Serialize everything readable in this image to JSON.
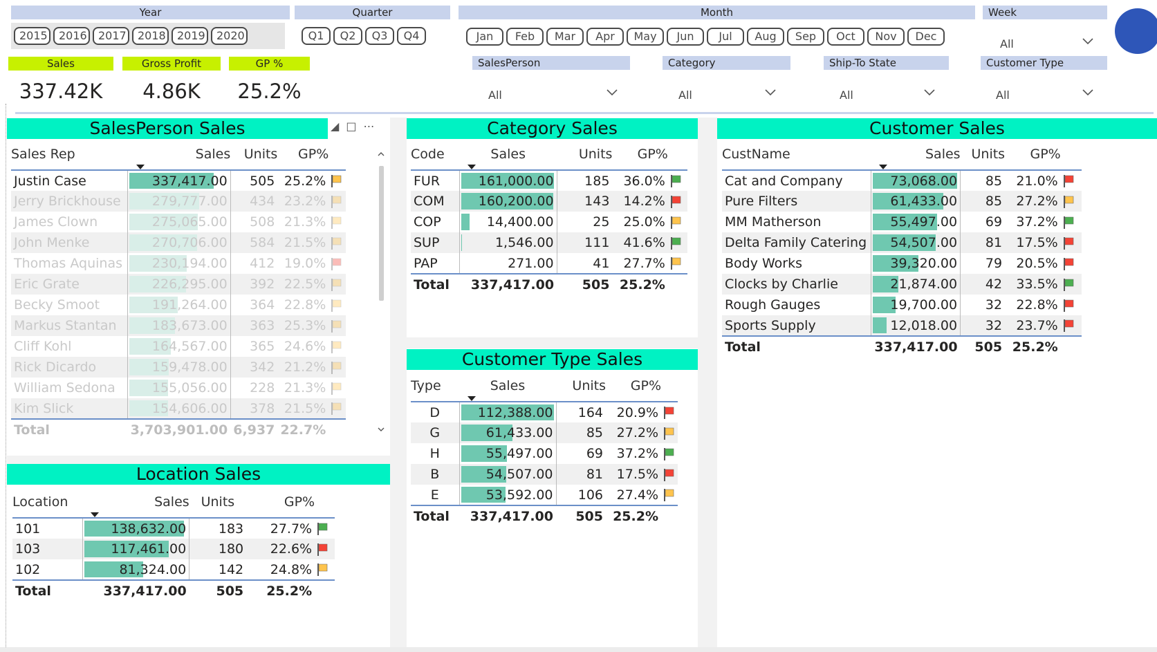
{
  "slicers": {
    "year": {
      "title": "Year",
      "options": [
        "2015",
        "2016",
        "2017",
        "2018",
        "2019",
        "2020"
      ]
    },
    "quarter": {
      "title": "Quarter",
      "options": [
        "Q1",
        "Q2",
        "Q3",
        "Q4"
      ]
    },
    "month": {
      "title": "Month",
      "options": [
        "Jan",
        "Feb",
        "Mar",
        "Apr",
        "May",
        "Jun",
        "Jul",
        "Aug",
        "Sep",
        "Oct",
        "Nov",
        "Dec"
      ]
    },
    "week": {
      "title": "Week",
      "value": "All"
    },
    "salesperson": {
      "title": "SalesPerson",
      "value": "All"
    },
    "category": {
      "title": "Category",
      "value": "All"
    },
    "ship_to_state": {
      "title": "Ship-To State",
      "value": "All"
    },
    "customer_type": {
      "title": "Customer Type",
      "value": "All"
    }
  },
  "kpis": {
    "sales": {
      "label": "Sales",
      "value": "337.42K"
    },
    "gross_profit": {
      "label": "Gross Profit",
      "value": "4.86K"
    },
    "gp_pct": {
      "label": "GP %",
      "value": "25.2%"
    }
  },
  "colors": {
    "accent": "#00f2c3",
    "kpi": "#c7f000",
    "bar": "#6fc8b0",
    "slicer": "#c8d3ec",
    "flag_green": "#4caf50",
    "flag_red": "#f44336",
    "flag_yellow": "#ffc44d"
  },
  "salesperson_sales": {
    "title": "SalesPerson Sales",
    "headers": [
      "Sales Rep",
      "Sales",
      "Units",
      "GP%"
    ],
    "rows": [
      {
        "name": "Justin Case",
        "sales": "337,417.00",
        "units": "505",
        "gp": "25.2%",
        "flag": "yellow",
        "pct": 1.0
      },
      {
        "name": "Jerry Brickhouse",
        "sales": "279,777.00",
        "units": "434",
        "gp": "23.2%",
        "flag": "yellow",
        "pct": 0.83
      },
      {
        "name": "James Clown",
        "sales": "275,065.00",
        "units": "508",
        "gp": "21.3%",
        "flag": "yellow",
        "pct": 0.815
      },
      {
        "name": "John Menke",
        "sales": "270,706.00",
        "units": "584",
        "gp": "21.5%",
        "flag": "yellow",
        "pct": 0.8
      },
      {
        "name": "Thomas Aquinas",
        "sales": "230,194.00",
        "units": "412",
        "gp": "19.0%",
        "flag": "red",
        "pct": 0.68
      },
      {
        "name": "Eric Grate",
        "sales": "226,295.00",
        "units": "392",
        "gp": "22.5%",
        "flag": "yellow",
        "pct": 0.67
      },
      {
        "name": "Becky Smoot",
        "sales": "191,264.00",
        "units": "364",
        "gp": "22.8%",
        "flag": "yellow",
        "pct": 0.57
      },
      {
        "name": "Markus Stantan",
        "sales": "183,673.00",
        "units": "363",
        "gp": "25.3%",
        "flag": "yellow",
        "pct": 0.54
      },
      {
        "name": "Cliff Kohl",
        "sales": "164,567.00",
        "units": "365",
        "gp": "24.6%",
        "flag": "yellow",
        "pct": 0.49
      },
      {
        "name": "Rick Dicardo",
        "sales": "159,478.00",
        "units": "342",
        "gp": "21.2%",
        "flag": "yellow",
        "pct": 0.47
      },
      {
        "name": "William Sedona",
        "sales": "155,056.00",
        "units": "228",
        "gp": "21.3%",
        "flag": "yellow",
        "pct": 0.46
      },
      {
        "name": "Kim Slick",
        "sales": "154,606.00",
        "units": "378",
        "gp": "21.5%",
        "flag": "yellow",
        "pct": 0.46
      }
    ],
    "total": {
      "label": "Total",
      "sales": "3,703,901.00",
      "units": "6,937",
      "gp": "22.7%"
    }
  },
  "location_sales": {
    "title": "Location Sales",
    "headers": [
      "Location",
      "Sales",
      "Units",
      "GP%"
    ],
    "rows": [
      {
        "name": "101",
        "sales": "138,632.00",
        "units": "183",
        "gp": "27.7%",
        "flag": "green",
        "pct": 1.0
      },
      {
        "name": "103",
        "sales": "117,461.00",
        "units": "180",
        "gp": "22.6%",
        "flag": "red",
        "pct": 0.85
      },
      {
        "name": "102",
        "sales": "81,324.00",
        "units": "142",
        "gp": "24.8%",
        "flag": "yellow",
        "pct": 0.59
      }
    ],
    "total": {
      "label": "Total",
      "sales": "337,417.00",
      "units": "505",
      "gp": "25.2%"
    }
  },
  "category_sales": {
    "title": "Category Sales",
    "headers": [
      "Code",
      "Sales",
      "Units",
      "GP%"
    ],
    "rows": [
      {
        "name": "FUR",
        "sales": "161,000.00",
        "units": "185",
        "gp": "36.0%",
        "flag": "green",
        "pct": 1.0
      },
      {
        "name": "COM",
        "sales": "160,200.00",
        "units": "143",
        "gp": "14.2%",
        "flag": "red",
        "pct": 0.995
      },
      {
        "name": "COP",
        "sales": "14,400.00",
        "units": "25",
        "gp": "25.0%",
        "flag": "yellow",
        "pct": 0.09
      },
      {
        "name": "SUP",
        "sales": "1,546.00",
        "units": "111",
        "gp": "41.6%",
        "flag": "green",
        "pct": 0.01
      },
      {
        "name": "PAP",
        "sales": "271.00",
        "units": "41",
        "gp": "27.7%",
        "flag": "yellow",
        "pct": 0.0
      }
    ],
    "total": {
      "label": "Total",
      "sales": "337,417.00",
      "units": "505",
      "gp": "25.2%"
    }
  },
  "customer_type_sales": {
    "title": "Customer Type Sales",
    "headers": [
      "Type",
      "Sales",
      "Units",
      "GP%"
    ],
    "rows": [
      {
        "name": "D",
        "sales": "112,388.00",
        "units": "164",
        "gp": "20.9%",
        "flag": "red",
        "pct": 1.0
      },
      {
        "name": "G",
        "sales": "61,433.00",
        "units": "85",
        "gp": "27.2%",
        "flag": "yellow",
        "pct": 0.55
      },
      {
        "name": "H",
        "sales": "55,497.00",
        "units": "69",
        "gp": "37.2%",
        "flag": "green",
        "pct": 0.49
      },
      {
        "name": "B",
        "sales": "54,507.00",
        "units": "81",
        "gp": "17.5%",
        "flag": "red",
        "pct": 0.485
      },
      {
        "name": "E",
        "sales": "53,592.00",
        "units": "106",
        "gp": "27.4%",
        "flag": "yellow",
        "pct": 0.48
      }
    ],
    "total": {
      "label": "Total",
      "sales": "337,417.00",
      "units": "505",
      "gp": "25.2%"
    }
  },
  "customer_sales": {
    "title": "Customer Sales",
    "headers": [
      "CustName",
      "Sales",
      "Units",
      "GP%"
    ],
    "rows": [
      {
        "name": "Cat and Company",
        "sales": "73,068.00",
        "units": "85",
        "gp": "21.0%",
        "flag": "red",
        "pct": 1.0
      },
      {
        "name": "Pure Filters",
        "sales": "61,433.00",
        "units": "85",
        "gp": "27.2%",
        "flag": "yellow",
        "pct": 0.84
      },
      {
        "name": "MM Matherson",
        "sales": "55,497.00",
        "units": "69",
        "gp": "37.2%",
        "flag": "green",
        "pct": 0.76
      },
      {
        "name": "Delta Family Catering",
        "sales": "54,507.00",
        "units": "81",
        "gp": "17.5%",
        "flag": "red",
        "pct": 0.745
      },
      {
        "name": "Body Works",
        "sales": "39,320.00",
        "units": "79",
        "gp": "20.5%",
        "flag": "red",
        "pct": 0.54
      },
      {
        "name": "Clocks by Charlie",
        "sales": "21,874.00",
        "units": "42",
        "gp": "33.5%",
        "flag": "green",
        "pct": 0.3
      },
      {
        "name": "Rough Gauges",
        "sales": "19,700.00",
        "units": "32",
        "gp": "22.8%",
        "flag": "red",
        "pct": 0.27
      },
      {
        "name": "Sports Supply",
        "sales": "12,018.00",
        "units": "32",
        "gp": "23.7%",
        "flag": "red",
        "pct": 0.16
      }
    ],
    "total": {
      "label": "Total",
      "sales": "337,417.00",
      "units": "505",
      "gp": "25.2%"
    }
  }
}
